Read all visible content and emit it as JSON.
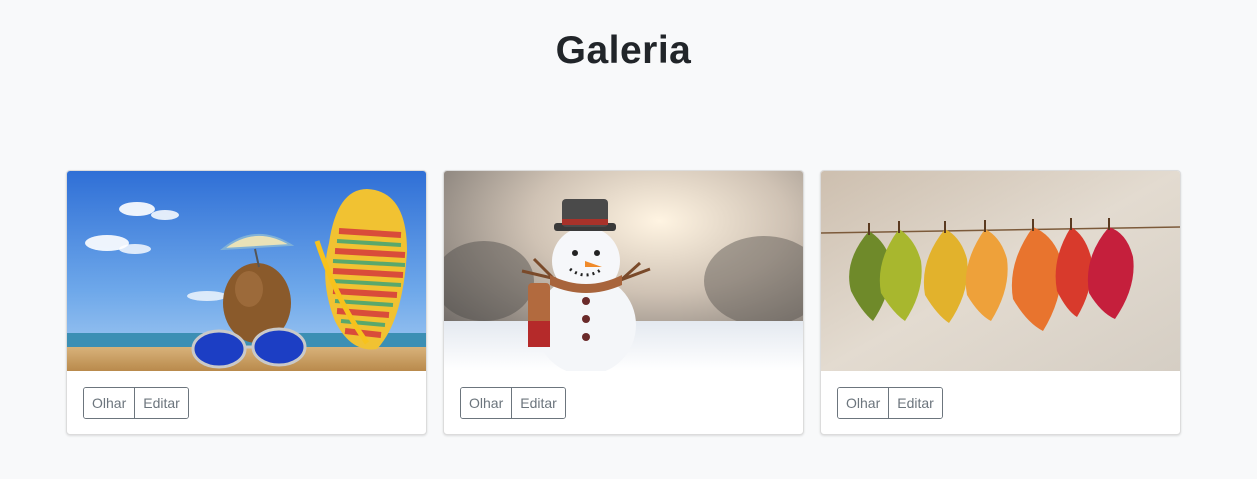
{
  "page": {
    "title": "Galeria"
  },
  "cards": [
    {
      "image": "beach-summer-image",
      "view_label": "Olhar",
      "edit_label": "Editar"
    },
    {
      "image": "snowman-winter-image",
      "view_label": "Olhar",
      "edit_label": "Editar"
    },
    {
      "image": "autumn-leaves-image",
      "view_label": "Olhar",
      "edit_label": "Editar"
    }
  ],
  "colors": {
    "background": "#f8f9fa",
    "button_border": "#6c757d",
    "title": "#212529"
  }
}
